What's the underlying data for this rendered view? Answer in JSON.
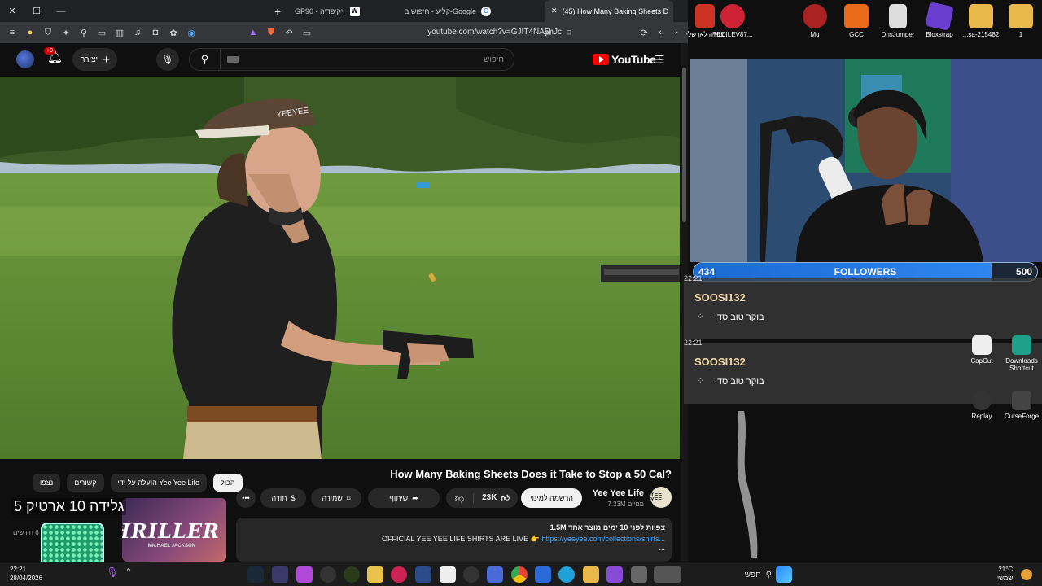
{
  "browser": {
    "tabs": [
      {
        "label": "GP90 - ויקיפדיה",
        "icon": "wikipedia-icon"
      },
      {
        "label": "קליע - חיפוש ב-Google",
        "icon": "google-icon"
      },
      {
        "label": "(45) How Many Baking Sheets D",
        "icon": "youtube-icon",
        "active": true
      }
    ],
    "url": "youtube.com/watch?v=GJIT4NA5hJc"
  },
  "youtube": {
    "notif_count": "+9",
    "create_label": "יצירה",
    "search_placeholder": "חיפוש",
    "logo": "YouTube",
    "logo_region": "IL"
  },
  "video": {
    "title": "How Many Baking Sheets Does it Take to Stop a 50 Cal?",
    "channel": "Yee Yee Life",
    "subscribers": "7.23M מנויים",
    "channel_avatar_text": "YEE YEE",
    "subscribe_label": "הרשמה למינוי",
    "likes": "23K",
    "share_label": "שיתוף",
    "save_label": "שמירה",
    "thanks_label": "תודה",
    "description_meta": "1.5M צפיות  לפני 10 ימים  מוצר אחד",
    "description_line": "OFFICIAL YEE YEE LIFE SHIRTS ARE LIVE 👉",
    "description_link": "https://yeeyee.com/collections/shirts...",
    "description_more": "..."
  },
  "sidebar": {
    "chips": [
      "נצפו",
      "קשורים",
      "הועלה על ידי Yee Yee Life",
      "הכול"
    ],
    "active_chip": 3,
    "overlay_text": "גלידה 10 ארטיק 5",
    "card_title": "THRILLER",
    "card_subtitle": "MICHAEL JACKSON",
    "card_meta": "לפני 6 חודשים"
  },
  "stream": {
    "followers_current": "434",
    "followers_label": "FOLLOWERS",
    "followers_goal": "500",
    "followers_progress": 0.868,
    "chat": [
      {
        "time": "22:21",
        "user": "SOOSI132",
        "message": "בוקר טוב סדי"
      },
      {
        "time": "22:21",
        "user": "SOOSI132",
        "message": "בוקר טוב סדי"
      }
    ]
  },
  "desktop_icons": [
    {
      "label": "צפייה לאן שלי",
      "color": "#cc3322"
    },
    {
      "label": "TEDILEV87...",
      "color": "#cc2233"
    },
    {
      "label": "Mu",
      "color": "#aa2222"
    },
    {
      "label": "GCC",
      "color": "#e86a1a"
    },
    {
      "label": "DnsJumper",
      "color": "#dddddd"
    },
    {
      "label": "Bloxstrap",
      "color": "#6a3fd0"
    },
    {
      "label": "...sa-215482",
      "color": "#e8b84a"
    },
    {
      "label": "1",
      "color": "#e8b84a"
    },
    {
      "label": "CapCut",
      "color": "#eeeeee"
    },
    {
      "label": "Downloads Shortcut",
      "color": "#1fa08a"
    },
    {
      "label": "Replay",
      "color": "#333333"
    },
    {
      "label": "CurseForge",
      "color": "#444444"
    }
  ],
  "taskbar": {
    "time": "22:21",
    "date": "28/04/2026",
    "search_label": "חפש",
    "temperature": "21°C",
    "weather_label": "שמשי"
  }
}
